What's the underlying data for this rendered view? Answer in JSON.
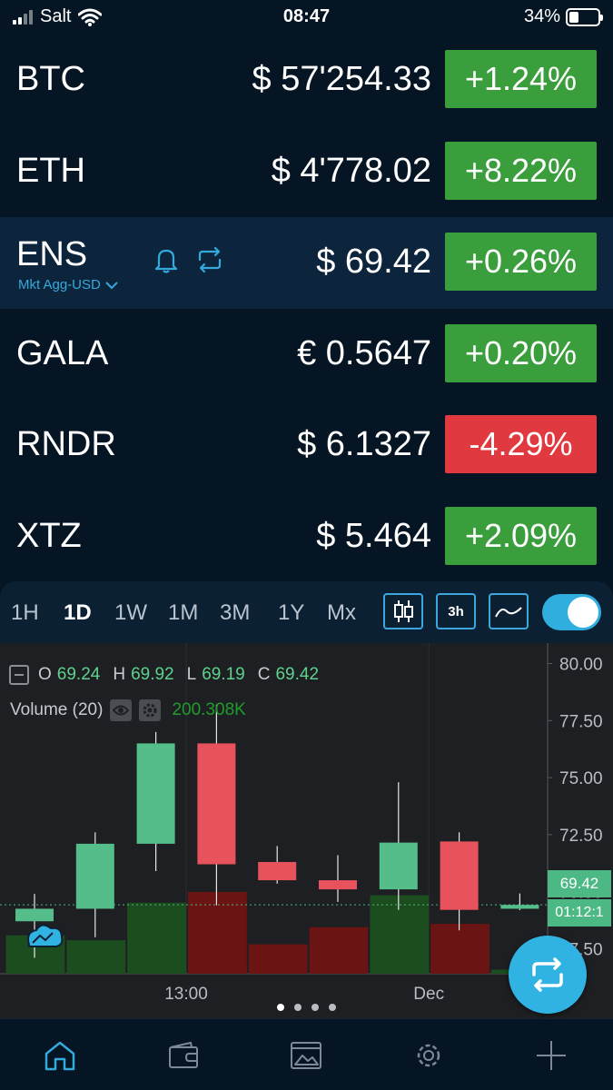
{
  "status_bar": {
    "carrier": "Salt",
    "time": "08:47",
    "battery": "34%",
    "battery_level": 0.34
  },
  "tickers": [
    {
      "symbol": "BTC",
      "price": "$ 57'254.33",
      "change": "+1.24%",
      "direction": "up"
    },
    {
      "symbol": "ETH",
      "price": "$ 4'778.02",
      "change": "+8.22%",
      "direction": "up"
    },
    {
      "symbol": "ENS",
      "market": "Mkt Agg-USD",
      "price": "$ 69.42",
      "change": "+0.26%",
      "direction": "up",
      "selected": true
    },
    {
      "symbol": "GALA",
      "price": "€ 0.5647",
      "change": "+0.20%",
      "direction": "up"
    },
    {
      "symbol": "RNDR",
      "price": "$ 6.1327",
      "change": "-4.29%",
      "direction": "down"
    },
    {
      "symbol": "XTZ",
      "price": "$ 5.464",
      "change": "+2.09%",
      "direction": "up"
    }
  ],
  "timeframes": [
    "1H",
    "1D",
    "1W",
    "1M",
    "3M",
    "1Y",
    "Mx"
  ],
  "active_timeframe": "1D",
  "chart_tools": {
    "interval_label": "3h"
  },
  "ohlc": {
    "o_label": "O",
    "o": "69.24",
    "h_label": "H",
    "h": "69.92",
    "l_label": "L",
    "l": "69.19",
    "c_label": "C",
    "c": "69.42"
  },
  "volume": {
    "label": "Volume (20)",
    "value": "200.308K"
  },
  "last_price_tag": "69.42",
  "countdown_tag": "01:12:1",
  "chart_data": {
    "type": "candlestick",
    "y_ticks": [
      "80.00",
      "77.50",
      "75.00",
      "72.50",
      "70.00",
      "67.50"
    ],
    "ylim": [
      66.4,
      80.5
    ],
    "x_labels": [
      {
        "label": "13:00",
        "index": 2.5
      },
      {
        "label": "Dec",
        "index": 6.5
      }
    ],
    "candles": [
      {
        "open": 68.7,
        "high": 69.9,
        "low": 67.1,
        "close": 69.25
      },
      {
        "open": 69.25,
        "high": 72.6,
        "low": 68.0,
        "close": 72.1
      },
      {
        "open": 72.1,
        "high": 77.0,
        "low": 70.9,
        "close": 76.5
      },
      {
        "open": 76.5,
        "high": 78.2,
        "low": 69.4,
        "close": 71.2
      },
      {
        "open": 71.3,
        "high": 72.0,
        "low": 70.35,
        "close": 70.5
      },
      {
        "open": 70.5,
        "high": 71.6,
        "low": 69.55,
        "close": 70.1
      },
      {
        "open": 70.1,
        "high": 74.8,
        "low": 69.2,
        "close": 72.15
      },
      {
        "open": 72.2,
        "high": 72.6,
        "low": 68.3,
        "close": 69.2
      },
      {
        "open": 69.25,
        "high": 69.92,
        "low": 69.19,
        "close": 69.42
      }
    ],
    "volumes": [
      0.47,
      0.41,
      0.87,
      1.0,
      0.36,
      0.57,
      0.96,
      0.61,
      0.05
    ],
    "last_price": 69.42,
    "colors": {
      "up": "#55bd8a",
      "down": "#e8525c",
      "vol_up": "#1c4d1f",
      "vol_down": "#6b1414"
    }
  },
  "pager": {
    "count": 4,
    "active": 0
  },
  "nav": [
    "home",
    "wallet",
    "gallery",
    "settings",
    "add"
  ],
  "colors": {
    "accent": "#30b3e2",
    "up": "#3a9e3d",
    "down": "#e0393f",
    "background": "#061523"
  }
}
